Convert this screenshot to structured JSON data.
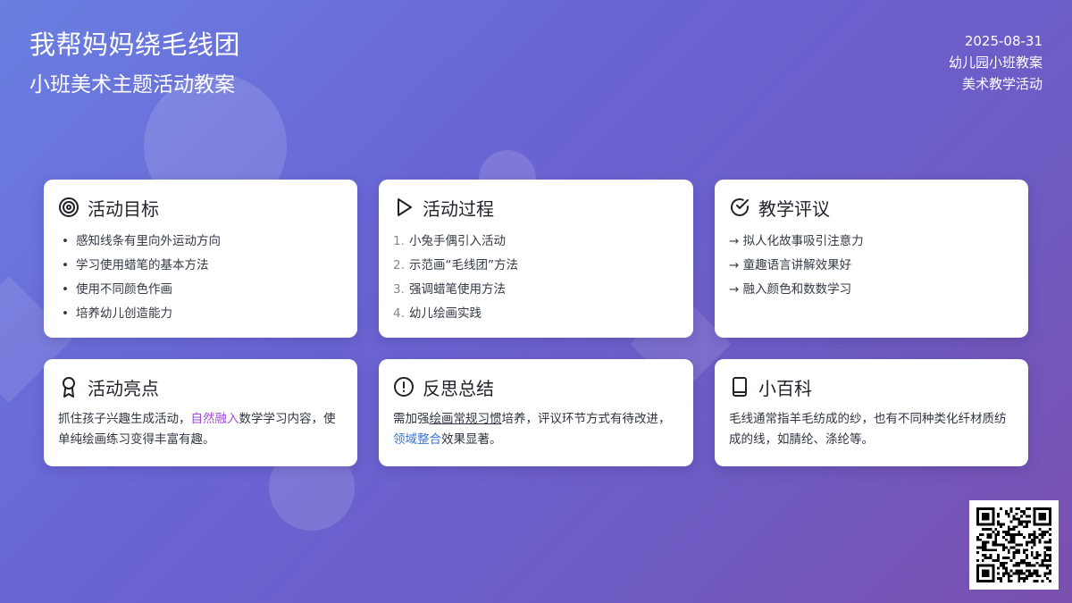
{
  "header": {
    "title": "我帮妈妈绕毛线团",
    "subtitle": "小班美术主题活动教案",
    "date": "2025-08-31",
    "grade": "幼儿园小班教案",
    "category": "美术教学活动"
  },
  "cards": {
    "goals": {
      "title": "活动目标",
      "icon": "target-icon",
      "items": [
        "感知线条有里向外运动方向",
        "学习使用蜡笔的基本方法",
        "使用不同颜色作画",
        "培养幼儿创造能力"
      ]
    },
    "process": {
      "title": "活动过程",
      "icon": "play-icon",
      "items": [
        {
          "num": "1.",
          "text": "小兔手偶引入活动"
        },
        {
          "num": "2.",
          "text": "示范画“毛线团”方法"
        },
        {
          "num": "3.",
          "text": "强调蜡笔使用方法"
        },
        {
          "num": "4.",
          "text": "幼儿绘画实践"
        }
      ]
    },
    "review": {
      "title": "教学评议",
      "icon": "check-circle-icon",
      "items": [
        "→ 拟人化故事吸引注意力",
        "→ 童趣语言讲解效果好",
        "→ 融入颜色和数数学习"
      ]
    },
    "highlights": {
      "title": "活动亮点",
      "icon": "award-icon",
      "text_1": "抓住孩子兴趣生成活动，",
      "emphasis": "自然融入",
      "text_2": "数学学习内容，使单纯绘画练习变得丰富有趣。"
    },
    "reflection": {
      "title": "反思总结",
      "icon": "alert-circle-icon",
      "text_1": "需加强",
      "emphasis_1": "绘画常规习惯",
      "text_2": "培养，评议环节方式有待改进，",
      "emphasis_2": "领域整合",
      "text_3": "效果显著。"
    },
    "wiki": {
      "title": "小百科",
      "icon": "book-icon",
      "text": "毛线通常指羊毛纺成的纱，也有不同种类化纤材质纺成的线，如腈纶、涤纶等。"
    }
  },
  "colors": {
    "accent_purple": "#9b4fcf",
    "accent_blue": "#3a73d6"
  }
}
